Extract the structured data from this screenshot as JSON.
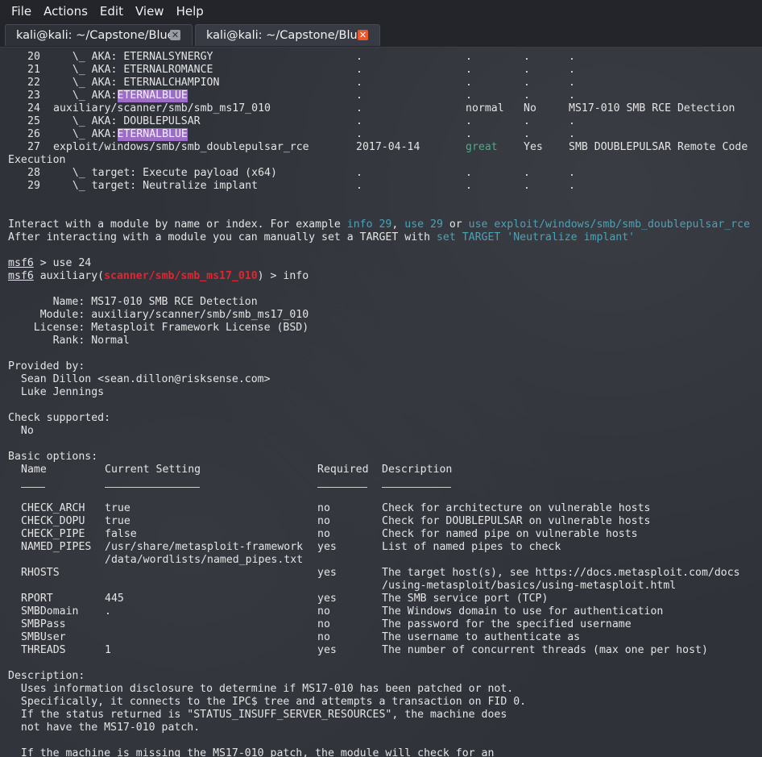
{
  "menu": [
    "File",
    "Actions",
    "Edit",
    "View",
    "Help"
  ],
  "tabs": [
    {
      "title": "kali@kali: ~/Capstone/Blue",
      "close": "✕"
    },
    {
      "title": "kali@kali: ~/Capstone/Blue",
      "close": "✕"
    }
  ],
  "search_rows": [
    {
      "idx": "20",
      "name": "   \\_ AKA: ETERNALSYNERGY",
      "date": ".",
      "rank": ".",
      "check": ".",
      "desc": "."
    },
    {
      "idx": "21",
      "name": "   \\_ AKA: ETERNALROMANCE",
      "date": ".",
      "rank": ".",
      "check": ".",
      "desc": "."
    },
    {
      "idx": "22",
      "name": "   \\_ AKA: ETERNALCHAMPION",
      "date": ".",
      "rank": ".",
      "check": ".",
      "desc": "."
    },
    {
      "idx": "23",
      "pre": "   \\_ AKA: ",
      "hl": "ETERNALBLUE",
      "date": ".",
      "rank": ".",
      "check": ".",
      "desc": "."
    },
    {
      "idx": "24",
      "name": "auxiliary/scanner/smb/smb_ms17_010",
      "date": ".",
      "rank": "normal",
      "check": "No",
      "desc": "MS17-010 SMB RCE Detection"
    },
    {
      "idx": "25",
      "name": "   \\_ AKA: DOUBLEPULSAR",
      "date": ".",
      "rank": ".",
      "check": ".",
      "desc": "."
    },
    {
      "idx": "26",
      "pre": "   \\_ AKA: ",
      "hl": "ETERNALBLUE",
      "date": ".",
      "rank": ".",
      "check": ".",
      "desc": "."
    },
    {
      "idx": "27",
      "name": "exploit/windows/smb/smb_doublepulsar_rce",
      "date": "2017-04-14",
      "rank": "great",
      "check": "Yes",
      "desc": "SMB DOUBLEPULSAR Remote Code"
    },
    {
      "wrap": "Execution"
    },
    {
      "idx": "28",
      "name": "   \\_ target: Execute payload (x64)",
      "date": ".",
      "rank": ".",
      "check": ".",
      "desc": "."
    },
    {
      "idx": "29",
      "name": "   \\_ target: Neutralize implant",
      "date": ".",
      "rank": ".",
      "check": ".",
      "desc": "."
    }
  ],
  "interact": {
    "a1": "Interact with a module by name or index. For example ",
    "a2": "info 29",
    "a3": ", ",
    "a4": "use 29",
    "a5": " or ",
    "a6": "use exploit/windows/smb/smb_doublepulsar_rce",
    "b1": "After interacting with a module you can manually set a TARGET with ",
    "b2": "set TARGET 'Neutralize implant'"
  },
  "prompt1": {
    "prefix": "msf6",
    "cmd": " > use 24"
  },
  "prompt2": {
    "prefix": "msf6",
    "mid": " auxiliary(",
    "module": "scanner/smb/smb_ms17_010",
    "cmd": ") > info"
  },
  "info": [
    "       Name: MS17-010 SMB RCE Detection",
    "     Module: auxiliary/scanner/smb/smb_ms17_010",
    "    License: Metasploit Framework License (BSD)",
    "       Rank: Normal"
  ],
  "provided_by": {
    "heading": "Provided by:",
    "authors": [
      "  Sean Dillon <sean.dillon@risksense.com>",
      "  Luke Jennings"
    ]
  },
  "check": {
    "heading": "Check supported:",
    "value": "  No"
  },
  "options": {
    "heading": "Basic options:",
    "headers": {
      "name": "Name",
      "setting": "Current Setting",
      "required": "Required",
      "desc": "Description"
    },
    "rows": [
      {
        "name": "CHECK_ARCH",
        "setting": "true",
        "required": "no",
        "desc": "Check for architecture on vulnerable hosts"
      },
      {
        "name": "CHECK_DOPU",
        "setting": "true",
        "required": "no",
        "desc": "Check for DOUBLEPULSAR on vulnerable hosts"
      },
      {
        "name": "CHECK_PIPE",
        "setting": "false",
        "required": "no",
        "desc": "Check for named pipe on vulnerable hosts"
      },
      {
        "name": "NAMED_PIPES",
        "setting": "/usr/share/metasploit-framework",
        "required": "yes",
        "desc": "List of named pipes to check"
      },
      {
        "name": "",
        "setting": "/data/wordlists/named_pipes.txt",
        "required": "",
        "desc": ""
      },
      {
        "name": "RHOSTS",
        "setting": "",
        "required": "yes",
        "desc": "The target host(s), see https://docs.metasploit.com/docs"
      },
      {
        "name": "",
        "setting": "",
        "required": "",
        "desc": "/using-metasploit/basics/using-metasploit.html"
      },
      {
        "name": "RPORT",
        "setting": "445",
        "required": "yes",
        "desc": "The SMB service port (TCP)"
      },
      {
        "name": "SMBDomain",
        "setting": ".",
        "required": "no",
        "desc": "The Windows domain to use for authentication"
      },
      {
        "name": "SMBPass",
        "setting": "",
        "required": "no",
        "desc": "The password for the specified username"
      },
      {
        "name": "SMBUser",
        "setting": "",
        "required": "no",
        "desc": "The username to authenticate as"
      },
      {
        "name": "THREADS",
        "setting": "1",
        "required": "yes",
        "desc": "The number of concurrent threads (max one per host)"
      }
    ]
  },
  "description": {
    "heading": "Description:",
    "lines": [
      "  Uses information disclosure to determine if MS17-010 has been patched or not.",
      "  Specifically, it connects to the IPC$ tree and attempts a transaction on FID 0.",
      "  If the status returned is \"STATUS_INSUFF_SERVER_RESOURCES\", the machine does",
      "  not have the MS17-010 patch.",
      "",
      "  If the machine is missing the MS17-010 patch, the module will check for an"
    ]
  },
  "colors": {
    "background": "#2f3239",
    "highlight": "#9b6dc7",
    "cyan": "#4aa3b8",
    "green": "#44b088",
    "red": "#e0262f",
    "tab_close_active": "#e8582c"
  }
}
